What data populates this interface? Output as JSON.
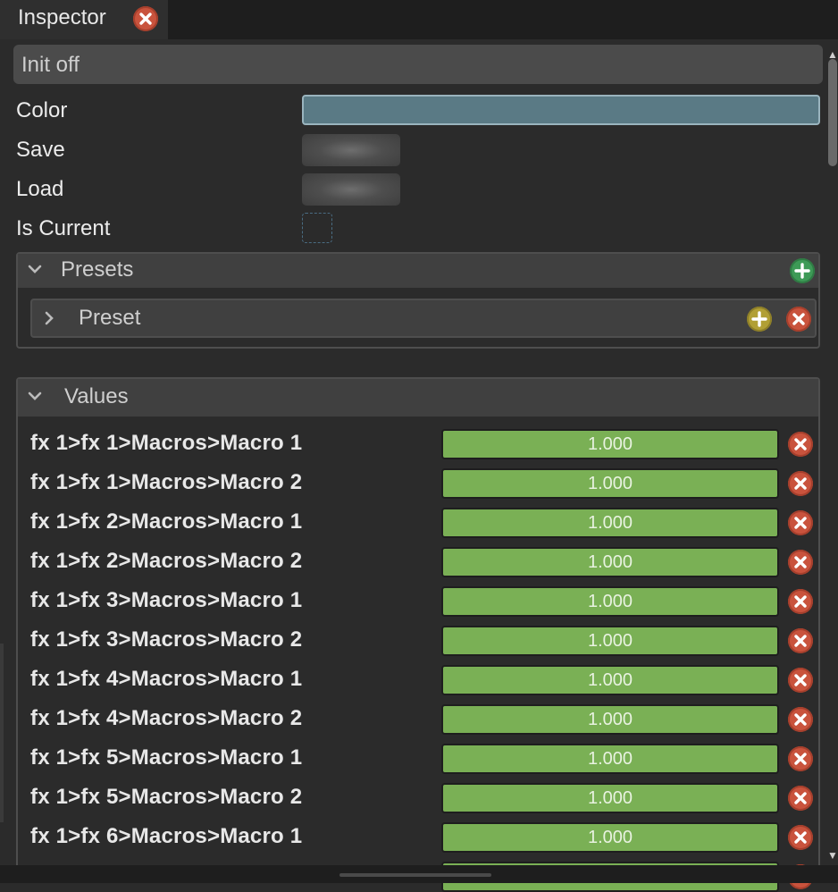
{
  "tab": {
    "title": "Inspector"
  },
  "header": {
    "title": "Init off"
  },
  "properties": {
    "color_label": "Color",
    "color_value": "#5a7a85",
    "save_label": "Save",
    "load_label": "Load",
    "is_current_label": "Is Current",
    "is_current_checked": false
  },
  "presets": {
    "title": "Presets",
    "items": [
      {
        "label": "Preset"
      }
    ]
  },
  "values": {
    "title": "Values",
    "rows": [
      {
        "label": "fx 1>fx 1>Macros>Macro 1",
        "value": "1.000",
        "fill": 1.0
      },
      {
        "label": "fx 1>fx 1>Macros>Macro 2",
        "value": "1.000",
        "fill": 1.0
      },
      {
        "label": "fx 1>fx 2>Macros>Macro 1",
        "value": "1.000",
        "fill": 1.0
      },
      {
        "label": "fx 1>fx 2>Macros>Macro 2",
        "value": "1.000",
        "fill": 1.0
      },
      {
        "label": "fx 1>fx 3>Macros>Macro 1",
        "value": "1.000",
        "fill": 1.0
      },
      {
        "label": "fx 1>fx 3>Macros>Macro 2",
        "value": "1.000",
        "fill": 1.0
      },
      {
        "label": "fx 1>fx 4>Macros>Macro 1",
        "value": "1.000",
        "fill": 1.0
      },
      {
        "label": "fx 1>fx 4>Macros>Macro 2",
        "value": "1.000",
        "fill": 1.0
      },
      {
        "label": "fx 1>fx 5>Macros>Macro 1",
        "value": "1.000",
        "fill": 1.0
      },
      {
        "label": "fx 1>fx 5>Macros>Macro 2",
        "value": "1.000",
        "fill": 1.0
      },
      {
        "label": "fx 1>fx 6>Macros>Macro 1",
        "value": "1.000",
        "fill": 1.0
      },
      {
        "label": "",
        "value": "",
        "fill": 1.0
      }
    ]
  },
  "colors": {
    "accent_green": "#7ab055",
    "remove_red": "#c9533d",
    "add_green": "#3d9a56",
    "add_yellow": "#b19f35"
  },
  "icons": {
    "tab_close": "close-icon",
    "presets_add": "plus-icon",
    "preset_add": "plus-icon",
    "preset_remove": "close-icon",
    "row_remove": "close-icon",
    "collapse": "chevron-down-icon",
    "expand": "chevron-right-icon"
  }
}
